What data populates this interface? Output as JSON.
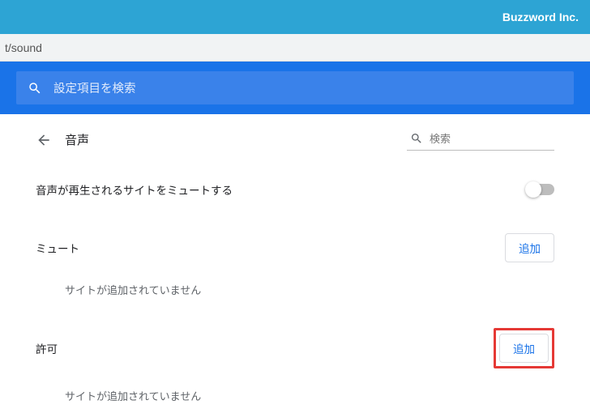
{
  "brand": "Buzzword Inc.",
  "url_fragment": "t/sound",
  "search": {
    "placeholder": "設定項目を検索"
  },
  "page": {
    "title": "音声",
    "filter_placeholder": "検索"
  },
  "settings": {
    "mute_sites_playing_sound": {
      "label": "音声が再生されるサイトをミュートする",
      "enabled": false
    }
  },
  "sections": {
    "mute": {
      "title": "ミュート",
      "add_label": "追加",
      "empty": "サイトが追加されていません"
    },
    "allow": {
      "title": "許可",
      "add_label": "追加",
      "empty": "サイトが追加されていません"
    }
  }
}
